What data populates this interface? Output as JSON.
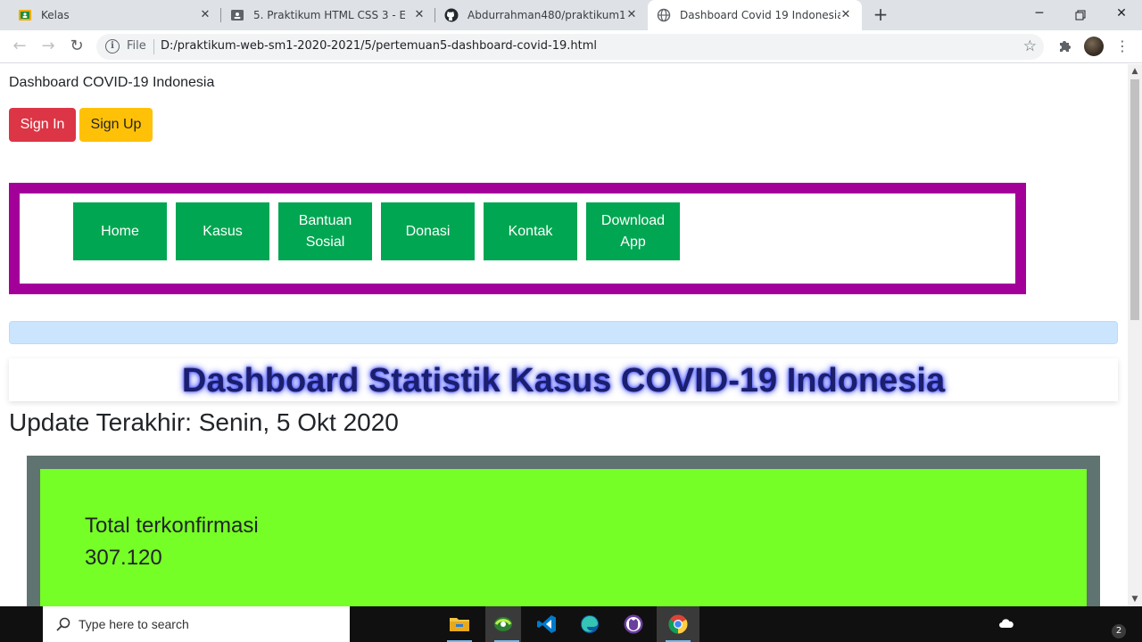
{
  "browser": {
    "tabs": [
      {
        "title": "Kelas",
        "icon": "google-classroom-icon"
      },
      {
        "title": "5. Praktikum HTML CSS 3 - Extern",
        "icon": "classroom-assignment-icon"
      },
      {
        "title": "Abdurrahman480/praktikum1-web",
        "icon": "github-icon"
      },
      {
        "title": "Dashboard Covid 19 Indonesia",
        "icon": "globe-icon"
      }
    ],
    "omnibox": {
      "scheme_label": "File",
      "url": "D:/praktikum-web-sm1-2020-2021/5/pertemuan5-dashboard-covid-19.html"
    }
  },
  "page": {
    "site_title": "Dashboard COVID-19 Indonesia",
    "signin_label": "Sign In",
    "signup_label": "Sign Up",
    "menu": [
      "Home",
      "Kasus",
      "Bantuan Sosial",
      "Donasi",
      "Kontak",
      "Download App"
    ],
    "headline": "Dashboard Statistik Kasus COVID-19 Indonesia",
    "update_text": "Update Terakhir: Senin, 5 Okt 2020",
    "stat": {
      "label": "Total terkonfirmasi",
      "value": "307.120"
    }
  },
  "taskbar": {
    "search_placeholder": "Type here to search",
    "notification_count": "2",
    "apps": [
      "file-explorer-icon",
      "app-icon",
      "vscode-icon",
      "edge-icon",
      "app-icon",
      "chrome-icon"
    ]
  },
  "colors": {
    "signin": "#dc3545",
    "signup": "#ffc107",
    "menu_border": "#a3009a",
    "menu_item": "#00a651",
    "alert": "#cce5ff",
    "stat_outer": "#5f7470",
    "stat_inner": "#76ff26",
    "headline_glow": "#2e3cff"
  }
}
